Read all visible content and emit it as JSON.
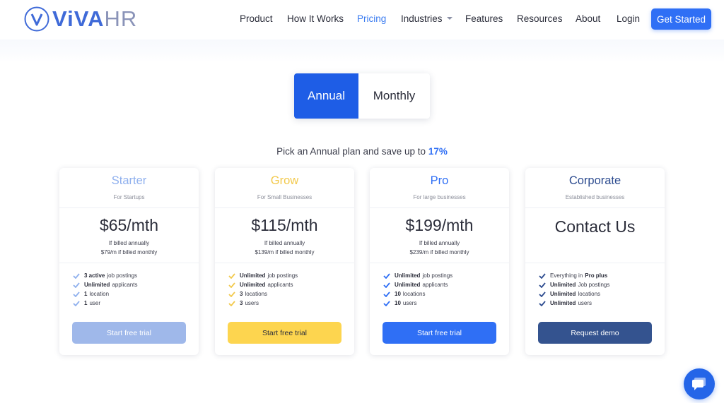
{
  "brand": {
    "logo_text_main": "ViVA",
    "logo_text_hr": "HR",
    "accent": "#2f6ff5"
  },
  "nav": {
    "items": [
      {
        "label": "Product"
      },
      {
        "label": "How It Works"
      },
      {
        "label": "Pricing"
      },
      {
        "label": "Industries"
      },
      {
        "label": "Features"
      },
      {
        "label": "Resources"
      },
      {
        "label": "About"
      },
      {
        "label": "Login"
      }
    ],
    "cta_label": "Get Started"
  },
  "billing_toggle": {
    "annual": "Annual",
    "monthly": "Monthly",
    "selected": "Annual"
  },
  "save_line": {
    "text": "Pick an Annual plan and save up to",
    "percent": "17%"
  },
  "plans": [
    {
      "name": "Starter",
      "subtitle": "For Startups",
      "title_color": "#8fb0ee",
      "price": "$65/mth",
      "billed_annually": "If billed annually",
      "billed_monthly": "$79/m if billed monthly",
      "features": [
        {
          "bold": "3 active",
          "text": "job postings"
        },
        {
          "bold": "Unlimited",
          "text": "applicants"
        },
        {
          "bold": "1",
          "text": "location"
        },
        {
          "bold": "1",
          "text": "user"
        }
      ],
      "check_color": "#8fb0ee",
      "cta_label": "Start free trial",
      "cta_bg": "#9fb8ea",
      "cta_fg": "#ffffff"
    },
    {
      "name": "Grow",
      "subtitle": "For Small Businesses",
      "title_color": "#f2c94c",
      "price": "$115/mth",
      "billed_annually": "If billed annually",
      "billed_monthly": "$139/m if billed monthly",
      "features": [
        {
          "bold": "Unlimited",
          "text": "job postings"
        },
        {
          "bold": "Unlimited",
          "text": "applicants"
        },
        {
          "bold": "3",
          "text": "locations"
        },
        {
          "bold": "3",
          "text": "users"
        }
      ],
      "check_color": "#f2c94c",
      "cta_label": "Start free trial",
      "cta_bg": "#fdd54f",
      "cta_fg": "#2b2d3a"
    },
    {
      "name": "Pro",
      "subtitle": "For large businesses",
      "title_color": "#2f6ff5",
      "price": "$199/mth",
      "billed_annually": "If billed annually",
      "billed_monthly": "$239/m if billed monthly",
      "features": [
        {
          "bold": "Unlimited",
          "text": "job postings"
        },
        {
          "bold": "Unlimited",
          "text": "applicants"
        },
        {
          "bold": "10",
          "text": "locations"
        },
        {
          "bold": "10",
          "text": "users"
        }
      ],
      "check_color": "#2f6ff5",
      "cta_label": "Start free trial",
      "cta_bg": "#2f6ff5",
      "cta_fg": "#ffffff"
    },
    {
      "name": "Corporate",
      "subtitle": "Established businesses",
      "title_color": "#2c4b8f",
      "price": "Contact Us",
      "billed_annually": "",
      "billed_monthly": "",
      "features": [
        {
          "bold": "",
          "text": "Everything in",
          "bold_after": "Pro plus"
        },
        {
          "bold": "Unlimited",
          "text": "Job postings"
        },
        {
          "bold": "Unlimited",
          "text": "locations"
        },
        {
          "bold": "Unlimited",
          "text": "users"
        }
      ],
      "check_color": "#2c4b8f",
      "cta_label": "Request demo",
      "cta_bg": "#34538f",
      "cta_fg": "#ffffff"
    }
  ],
  "chat_widget": {
    "icon": "chat-bubble-icon"
  }
}
